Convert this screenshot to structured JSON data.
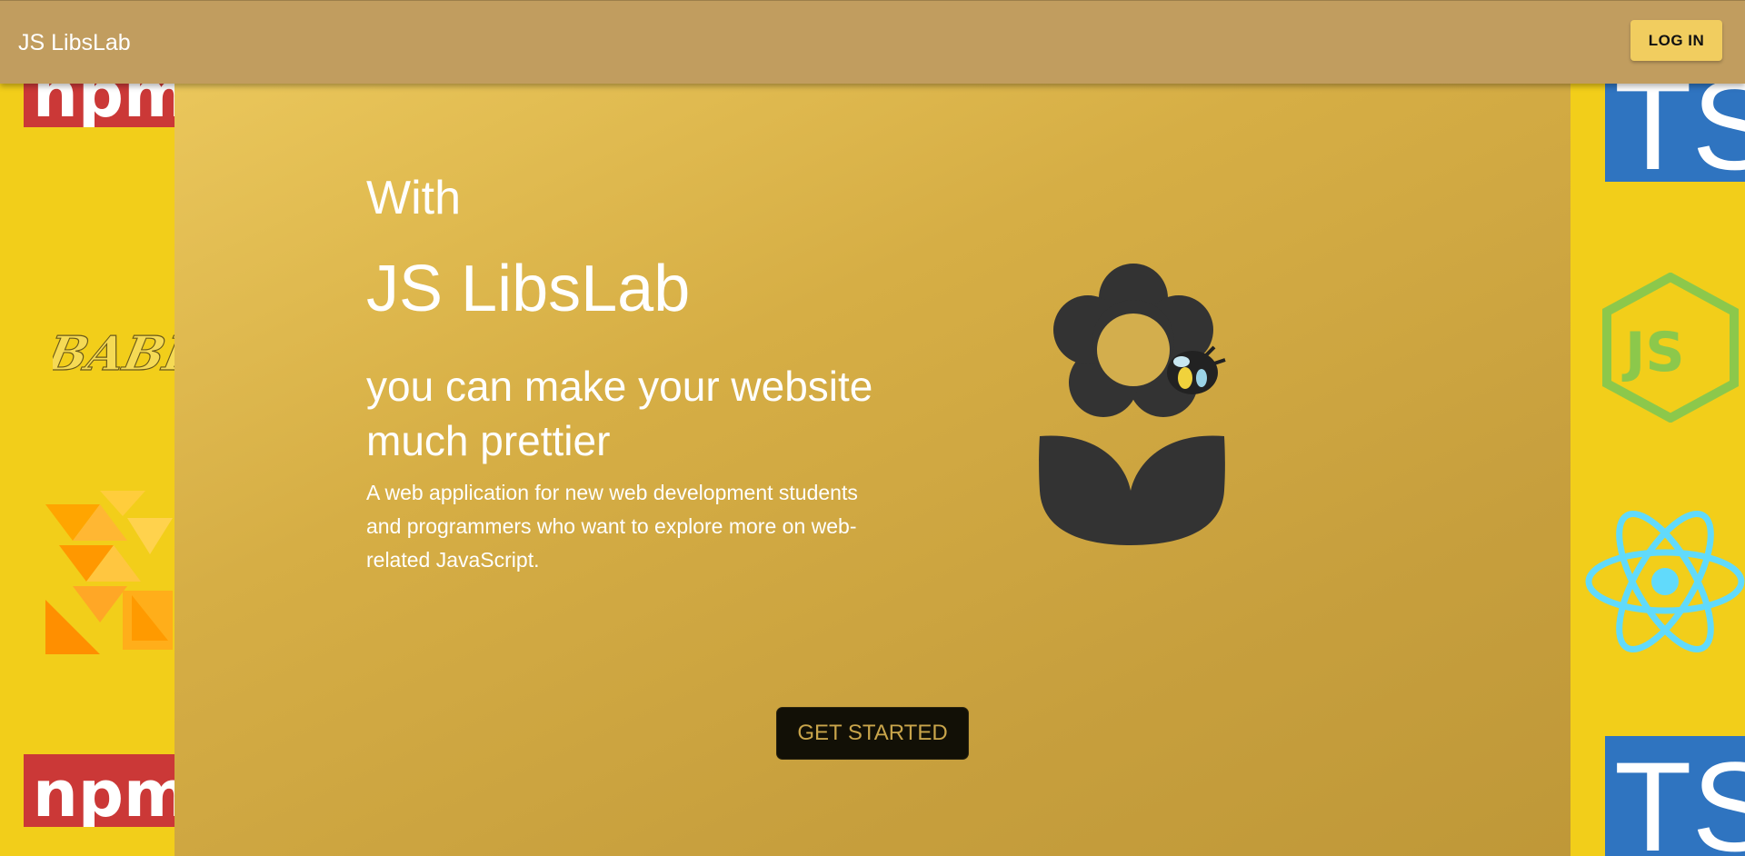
{
  "appbar": {
    "title": "JS LibsLab",
    "login_label": "LOG IN"
  },
  "hero": {
    "line_with": "With",
    "brand": "JS LibsLab",
    "tagline": "you can make your website much prettier",
    "description": "A web application for new web development students and programmers who want to explore more on web-related JavaScript.",
    "cta_label": "GET STARTED"
  },
  "decorations": {
    "left": [
      "npm-logo",
      "babel-logo",
      "flow-logo",
      "npm-logo"
    ],
    "right": [
      "typescript-logo",
      "nodejs-logo",
      "react-logo",
      "typescript-logo"
    ],
    "npm_text": "npm",
    "babel_text": "BABEL",
    "ts_text": "TS",
    "js_text": "JS"
  },
  "colors": {
    "background": "#f2ce1a",
    "appbar": "#c19d5f",
    "login_button": "#f1cd5f",
    "cta_background": "#121006",
    "cta_text": "#c9a54b",
    "logo_dark": "#333333"
  }
}
